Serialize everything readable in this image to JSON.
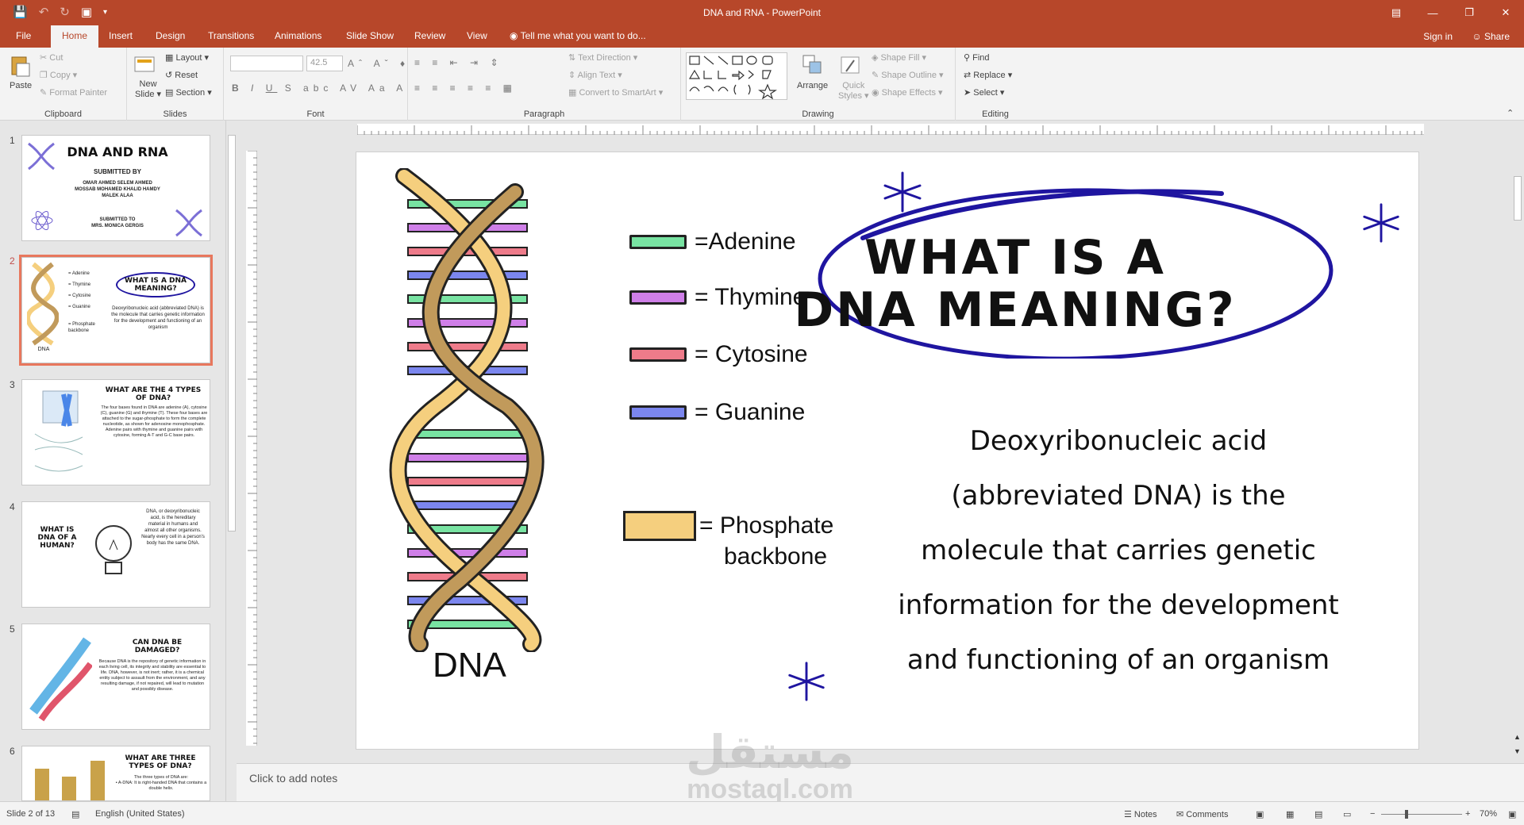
{
  "titlebar": {
    "title": "DNA and RNA - PowerPoint"
  },
  "tabs": [
    "File",
    "Home",
    "Insert",
    "Design",
    "Transitions",
    "Animations",
    "Slide Show",
    "Review",
    "View"
  ],
  "tell_me": "Tell me what you want to do...",
  "account": {
    "signin": "Sign in",
    "share": "Share"
  },
  "ribbon": {
    "clipboard": {
      "label": "Clipboard",
      "paste": "Paste",
      "cut": "Cut",
      "copy": "Copy",
      "format_painter": "Format Painter"
    },
    "slides": {
      "label": "Slides",
      "new_slide_1": "New",
      "new_slide_2": "Slide",
      "layout": "Layout",
      "reset": "Reset",
      "section": "Section"
    },
    "font": {
      "label": "Font",
      "size": "42.5"
    },
    "paragraph": {
      "label": "Paragraph",
      "text_direction": "Text Direction",
      "align_text": "Align Text",
      "convert": "Convert to SmartArt"
    },
    "drawing": {
      "label": "Drawing",
      "arrange": "Arrange",
      "quick_styles_1": "Quick",
      "quick_styles_2": "Styles",
      "shape_fill": "Shape Fill",
      "shape_outline": "Shape Outline",
      "shape_effects": "Shape Effects"
    },
    "editing": {
      "label": "Editing",
      "find": "Find",
      "replace": "Replace",
      "select": "Select"
    }
  },
  "thumbnails": [
    {
      "num": "1",
      "title": "DNA AND RNA",
      "subtitle": "SUBMITTED BY",
      "names": "OMAR AHMED    SELEM AHMED\nMOSSAB MOHAMED    KHALID HAMDY\nMALEK ALAA",
      "footer": "SUBMITTED TO\nMRS. MONICA GERGIS"
    },
    {
      "num": "2",
      "title": "WHAT IS A DNA MEANING?",
      "legend": [
        "= Adenine",
        "= Thymine",
        "= Cytosine",
        "= Guanine",
        "= Phosphate backbone"
      ],
      "caption": "DNA",
      "text": "Deoxyribonucleic acid (abbreviated DNA) is the molecule that carries genetic information for the development and functioning of an organism"
    },
    {
      "num": "3",
      "title": "WHAT ARE THE 4 TYPES OF DNA?",
      "text": "The four bases found in DNA are adenine (A), cytosine (C), guanine (G) and thymine (T). These four bases are attached to the sugar-phosphate to form the complete nucleotide, as shown for adenosine monophosphate. Adenine pairs with thymine and guanine pairs with cytosine, forming A-T and G-C base pairs."
    },
    {
      "num": "4",
      "title": "WHAT IS DNA OF A HUMAN?",
      "text": "DNA, or deoxyribonucleic acid, is the hereditary material in humans and almost all other organisms. Nearly every cell in a person's body has the same DNA."
    },
    {
      "num": "5",
      "title": "CAN DNA BE DAMAGED?",
      "text": "Because DNA is the repository of genetic information in each living cell, its integrity and stability are essential to life. DNA, however, is not inert; rather, it is a chemical entity subject to assault from the environment, and any resulting damage, if not repaired, will lead to mutation and possibly disease."
    },
    {
      "num": "6",
      "title": "WHAT ARE THREE TYPES OF DNA?",
      "text": "The three types of DNA are:\n• A-DNA: It is right-handed DNA that contains a double helix."
    }
  ],
  "slide": {
    "legend": [
      {
        "label": "=Adenine",
        "color": "#78e3a2"
      },
      {
        "label": "= Thymine",
        "color": "#cf7fe8"
      },
      {
        "label": "= Cytosine",
        "color": "#ee7b8a"
      },
      {
        "label": "= Guanine",
        "color": "#7b86ee"
      }
    ],
    "phosphate": {
      "line1": "= Phosphate",
      "line2": "backbone",
      "color": "#f5cf7e"
    },
    "dna_caption": "DNA",
    "title_line1": "WHAT IS A",
    "title_line2": "DNA MEANING?",
    "body_lines": [
      "Deoxyribonucleic acid",
      "(abbreviated DNA) is the",
      "molecule that carries genetic",
      "information for the development",
      "and functioning of an organism"
    ],
    "accent_color": "#1f15a0"
  },
  "notes": {
    "placeholder": "Click to add notes"
  },
  "status": {
    "slide_info": "Slide 2 of 13",
    "language": "English (United States)",
    "notes_btn": "Notes",
    "comments_btn": "Comments",
    "zoom": "70%"
  },
  "watermark": {
    "arabic": "مستقل",
    "latin": "mostaql.com"
  }
}
